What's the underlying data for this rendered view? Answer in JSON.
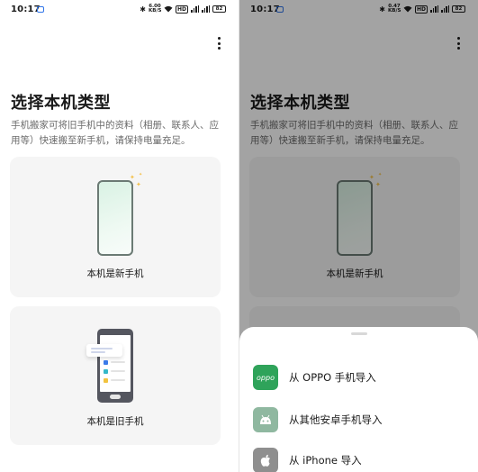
{
  "status_bar": {
    "time": "10:17",
    "net_speed_left": "6.00\nKB/S",
    "net_speed_right": "0.47\nKB/S",
    "hd_tag": "HD",
    "sim1_tag": "5G",
    "sim2_tag": "5G",
    "battery": "82"
  },
  "page": {
    "title": "选择本机类型",
    "description": "手机搬家可将旧手机中的资料（相册、联系人、应用等）快速搬至新手机，请保持电量充足。",
    "option_new": "本机是新手机",
    "option_old": "本机是旧手机"
  },
  "import_sheet": {
    "items": [
      {
        "label": "从 OPPO 手机导入",
        "icon": "oppo-logo-icon",
        "icon_text": "oppo"
      },
      {
        "label": "从其他安卓手机导入",
        "icon": "android-icon"
      },
      {
        "label": "从 iPhone 导入",
        "icon": "apple-icon"
      }
    ]
  },
  "colors": {
    "oppo_green": "#2fa35a",
    "android_green": "#8fb8a0",
    "apple_grey": "#8f8f8f",
    "card_bg": "#f5f5f5",
    "overlay": "rgba(0,0,0,0.36)"
  }
}
